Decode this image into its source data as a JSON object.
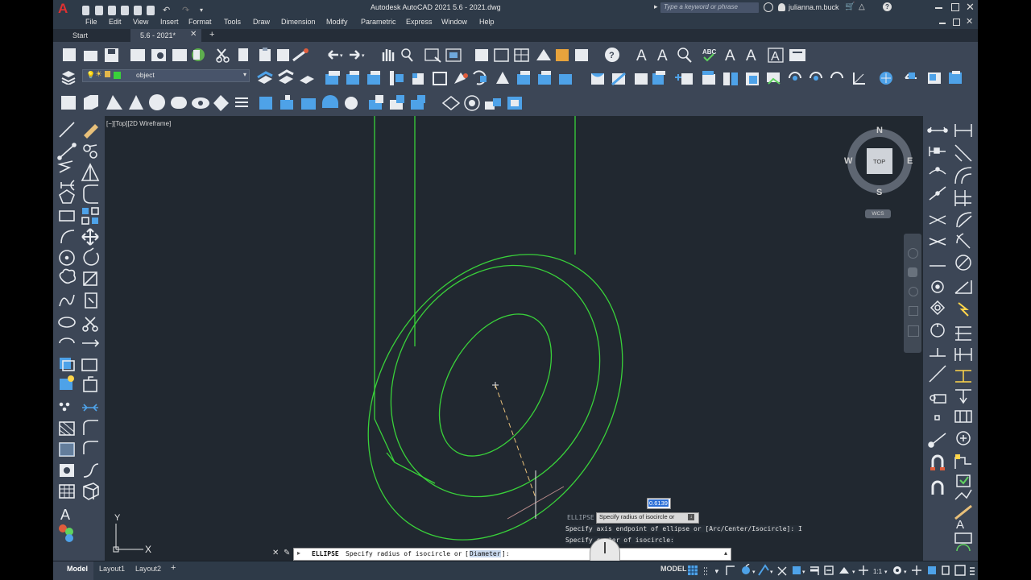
{
  "window": {
    "title": "Autodesk AutoCAD 2021   5.6 - 2021.dwg",
    "app_logo": "A",
    "search_placeholder": "Type a keyword or phrase",
    "user": "julianna.m.buck"
  },
  "menu": [
    "File",
    "Edit",
    "View",
    "Insert",
    "Format",
    "Tools",
    "Draw",
    "Dimension",
    "Modify",
    "Parametric",
    "Express",
    "Window",
    "Help"
  ],
  "doc_tabs": {
    "start": "Start",
    "active": "5.6 - 2021*",
    "add": "+"
  },
  "layer": {
    "name": "object"
  },
  "viewport": {
    "label": "[−][Top][2D Wireframe]"
  },
  "viewcube": {
    "n": "N",
    "s": "S",
    "e": "E",
    "w": "W",
    "face": "TOP",
    "wcs": "WCS"
  },
  "dynamic_input": {
    "value": "0.6139",
    "prompt_tag": "ELLIPSE",
    "prompt": "Specify radius of isocircle or",
    "prompt_btn": "↓",
    "history1": "Specify axis endpoint of ellipse or [Arc/Center/Isocircle]: I",
    "history2": "Specify center of isocircle:"
  },
  "command_line": {
    "command": "ELLIPSE",
    "text": "Specify radius of isocircle or",
    "option": "Diameter",
    "suffix": "]:",
    "open_bracket": "["
  },
  "status": {
    "tabs": [
      "Model",
      "Layout1",
      "Layout2"
    ],
    "add": "+",
    "mode": "MODEL",
    "scale": "1:1"
  },
  "colors": {
    "geometry": "#39d13a",
    "canvas": "#212830",
    "ui": "#3c4656",
    "accent": "#1d6fd6"
  }
}
